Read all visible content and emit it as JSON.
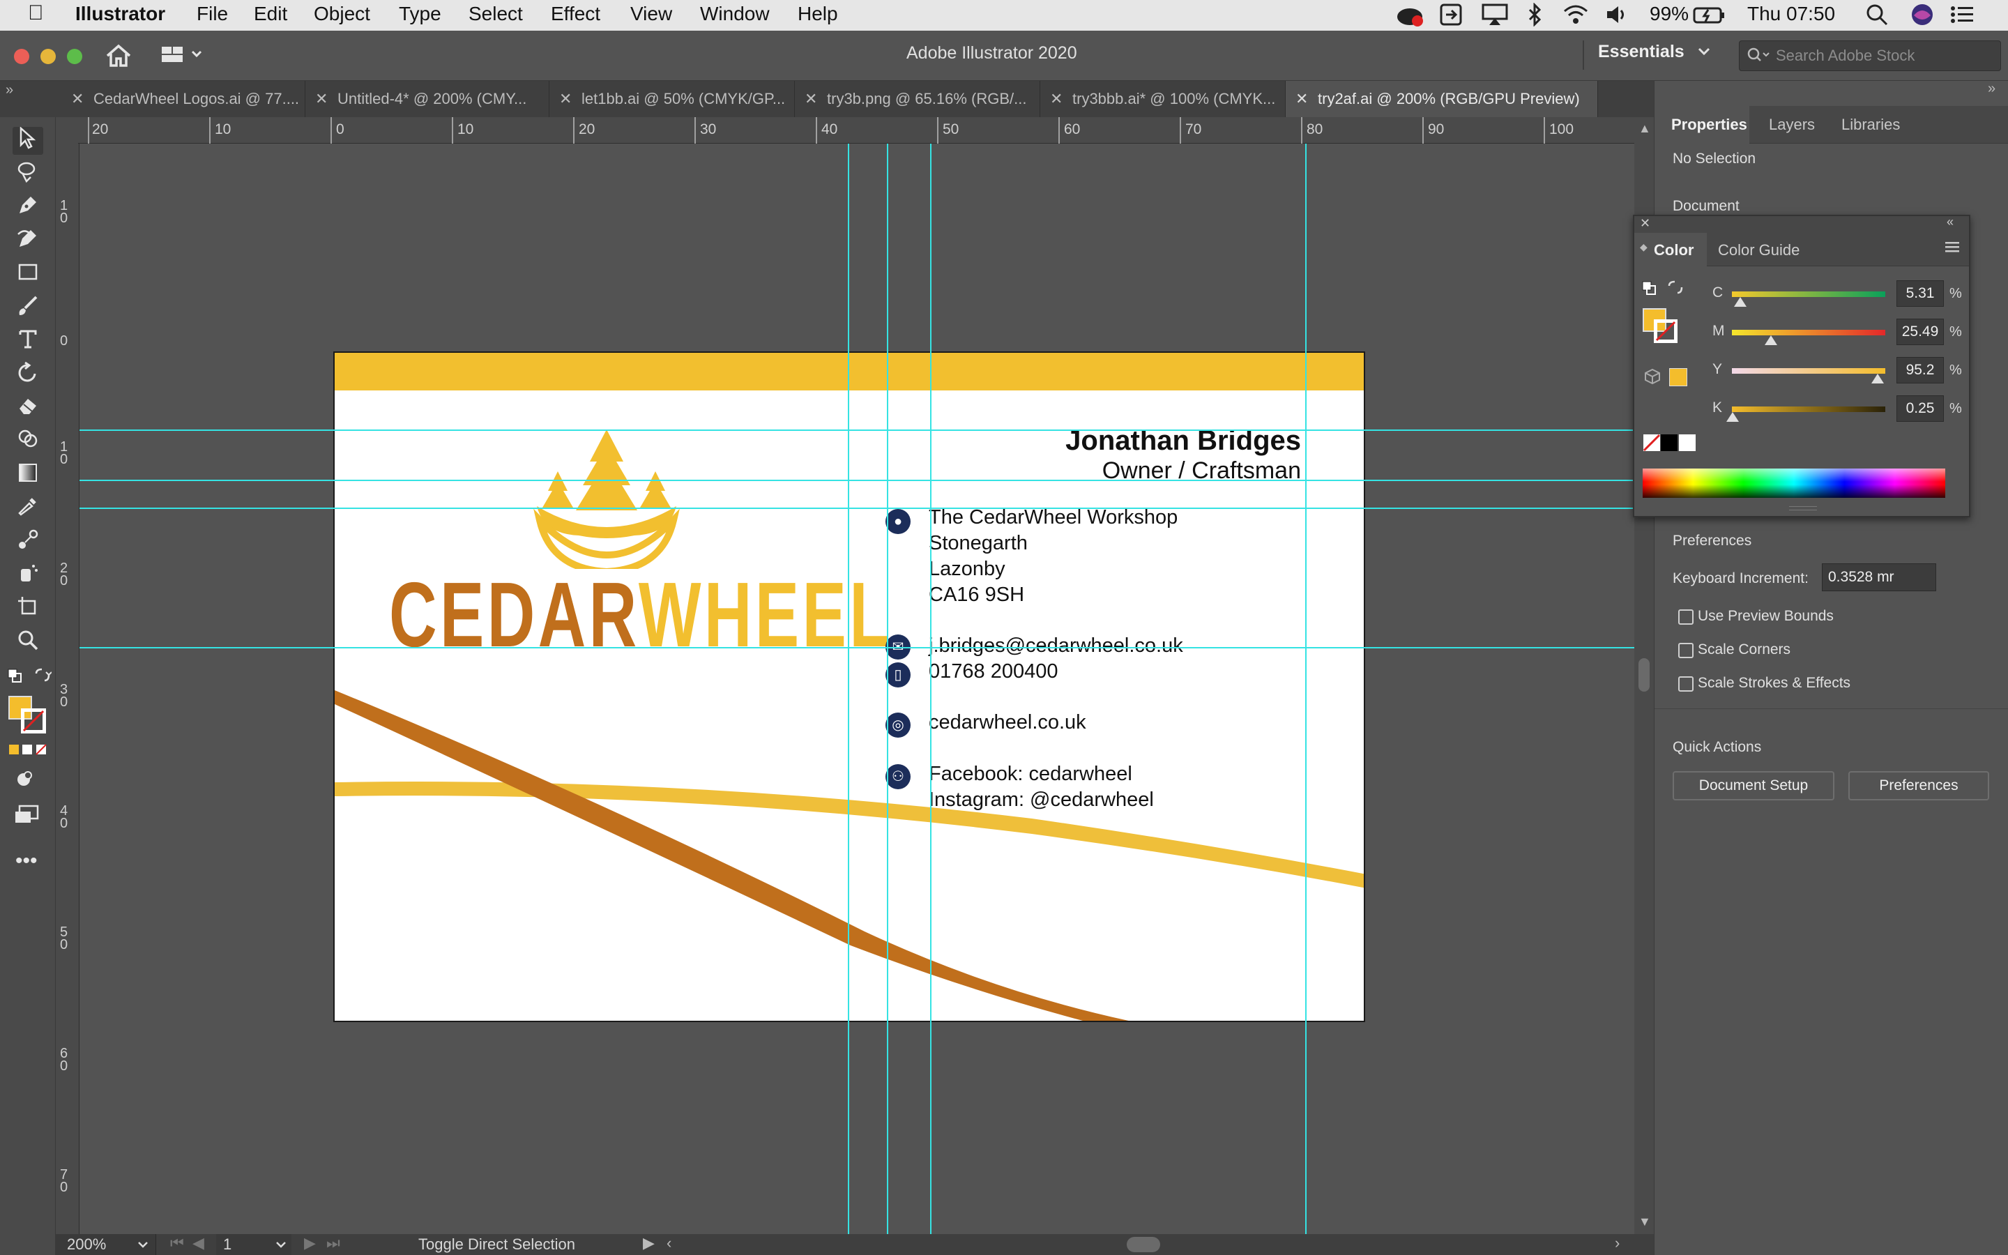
{
  "menubar": {
    "apple_icon": "apple-icon",
    "app_name": "Illustrator",
    "items": [
      "File",
      "Edit",
      "Object",
      "Type",
      "Select",
      "Effect",
      "View",
      "Window",
      "Help"
    ],
    "battery": "99%",
    "clock": "Thu 07:50"
  },
  "appbar": {
    "title": "Adobe Illustrator 2020",
    "workspace": "Essentials",
    "search_placeholder": "Search Adobe Stock"
  },
  "tabs": [
    {
      "label": "CedarWheel Logos.ai @ 77...."
    },
    {
      "label": "Untitled-4* @ 200% (CMY..."
    },
    {
      "label": "let1bb.ai @ 50% (CMYK/GP..."
    },
    {
      "label": "try3b.png @ 65.16% (RGB/..."
    },
    {
      "label": "try3bbb.ai* @ 100% (CMYK..."
    },
    {
      "label": "try2af.ai @ 200% (RGB/GPU Preview)"
    }
  ],
  "ruler": {
    "h_ticks": [
      "20",
      "10",
      "0",
      "10",
      "20",
      "30",
      "40",
      "50",
      "60",
      "70",
      "80",
      "90",
      "100"
    ],
    "v_ticks": [
      "1\n0",
      "0",
      "1\n0",
      "2\n0",
      "3\n0",
      "4\n0",
      "5\n0",
      "6\n0",
      "7\n0"
    ]
  },
  "card": {
    "logo_word_1": "CEDAR",
    "logo_word_2": "WHEEL",
    "name": "Jonathan Bridges",
    "role": "Owner / Craftsman",
    "address": [
      "The CedarWheel Workshop",
      "Stonegarth",
      "Lazonby",
      "CA16 9SH"
    ],
    "email": "j.bridges@cedarwheel.co.uk",
    "phone": "01768 200400",
    "website": "cedarwheel.co.uk",
    "facebook": "Facebook: cedarwheel",
    "instagram": "Instagram: @cedarwheel",
    "colors": {
      "gold": "#f2bf2f",
      "brown": "#c06f1c",
      "navy": "#1c2d5a"
    }
  },
  "properties": {
    "tabs": [
      "Properties",
      "Layers",
      "Libraries"
    ],
    "no_selection": "No Selection",
    "document": "Document",
    "preferences": "Preferences",
    "keyboard_increment_label": "Keyboard Increment:",
    "keyboard_increment_value": "0.3528 mr",
    "checkboxes": [
      "Use Preview Bounds",
      "Scale Corners",
      "Scale Strokes & Effects"
    ],
    "quick_actions": "Quick Actions",
    "document_setup": "Document Setup",
    "preferences_button": "Preferences"
  },
  "color_panel": {
    "tabs": [
      "Color",
      "Color Guide"
    ],
    "channels": [
      {
        "label": "C",
        "value": "5.31",
        "level": 0.0531
      },
      {
        "label": "M",
        "value": "25.49",
        "level": 0.2549
      },
      {
        "label": "Y",
        "value": "95.2",
        "level": 0.952
      },
      {
        "label": "K",
        "value": "0.25",
        "level": 0.0025
      }
    ],
    "pct": "%",
    "fill_color": "#f4bd2c"
  },
  "status": {
    "zoom": "200%",
    "artboard": "1",
    "tool_hint": "Toggle Direct Selection"
  }
}
